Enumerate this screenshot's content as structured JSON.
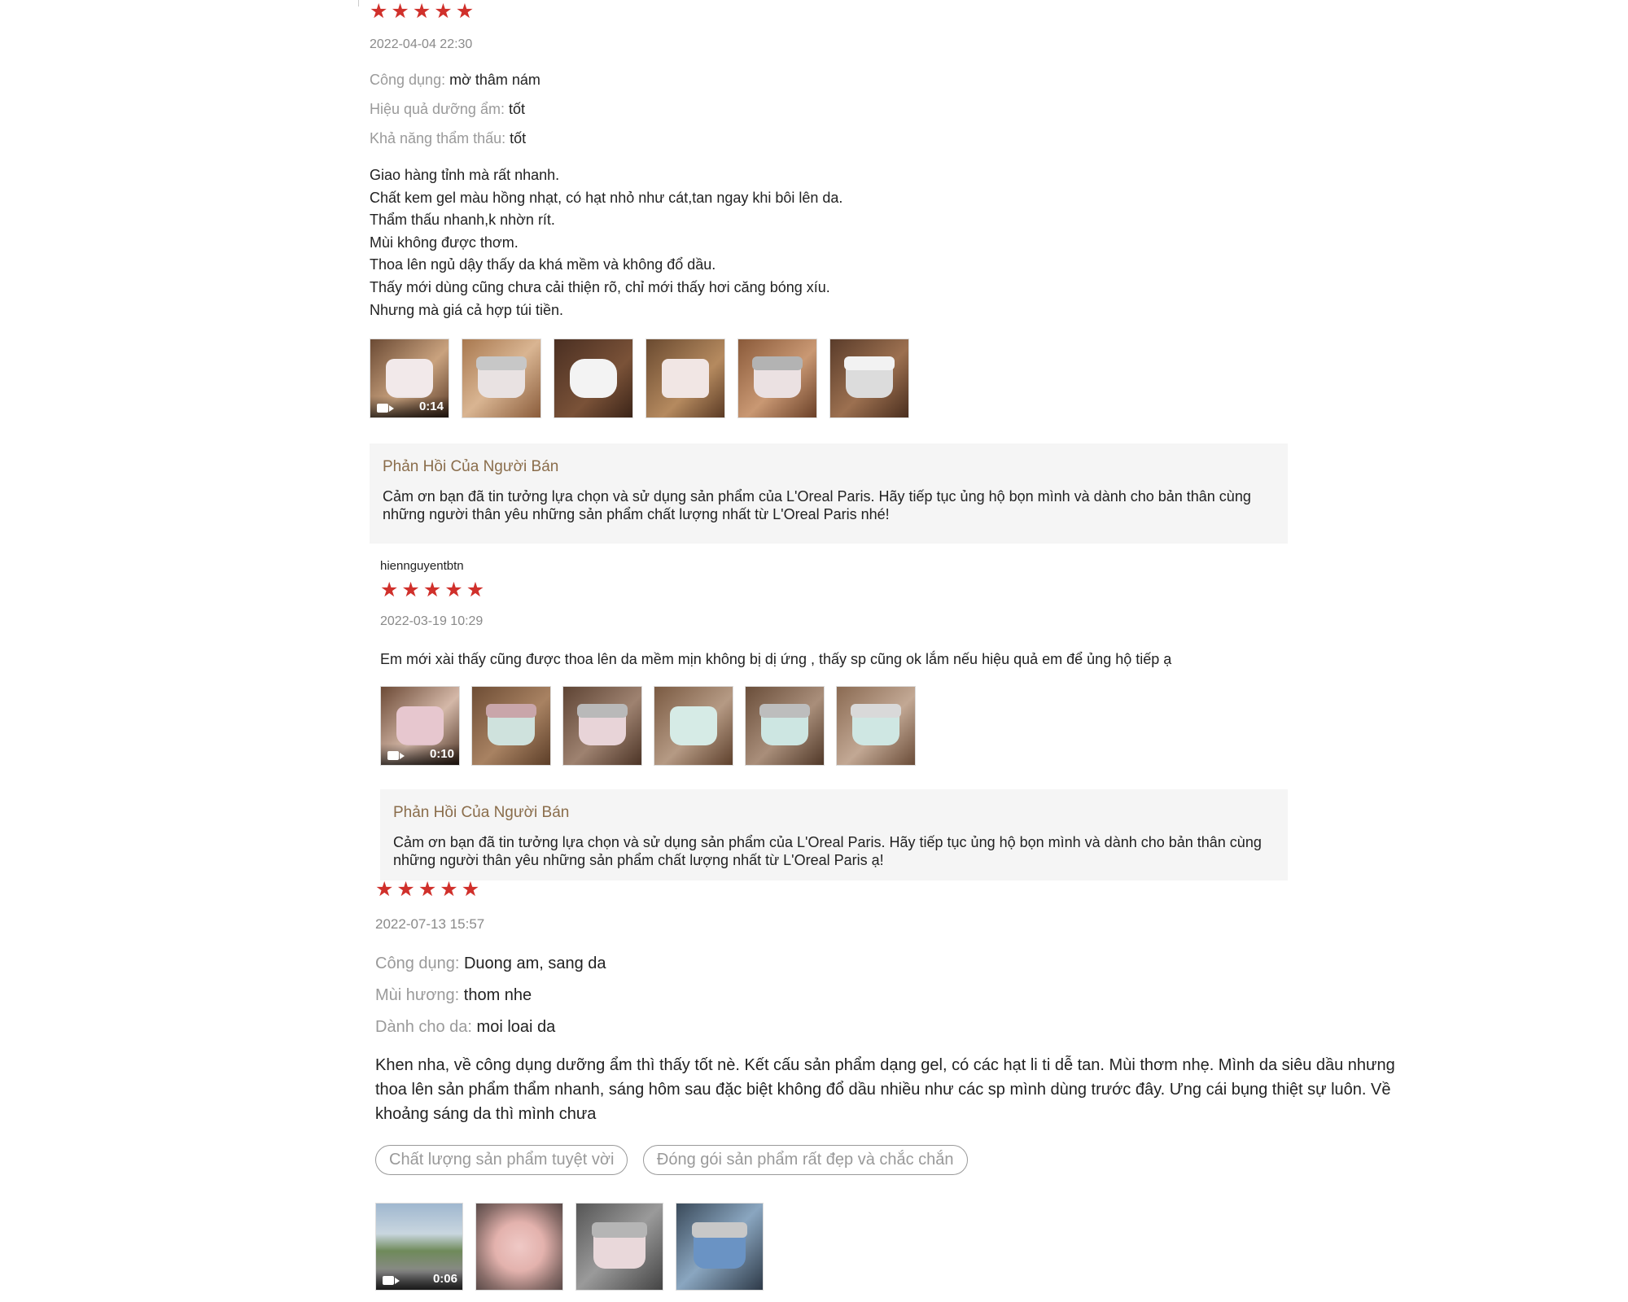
{
  "reviews": [
    {
      "username": "",
      "stars": 5,
      "date": "2022-04-04 22:30",
      "attributes": [
        {
          "label": "Công dụng:",
          "value": "mờ thâm nám"
        },
        {
          "label": "Hiệu quả dưỡng ẩm:",
          "value": "tốt"
        },
        {
          "label": "Khả năng thẩm thấu:",
          "value": "tốt"
        }
      ],
      "comment": "Giao hàng tỉnh mà rất nhanh.\nChất kem gel màu hồng nhạt, có hạt nhỏ như cát,tan ngay khi bôi lên da.\nThẩm thấu nhanh,k nhờn rít.\nMùi không được thơm.\nThoa lên ngủ dậy thấy da khá mềm và không đổ dầu.\nThấy mới dùng cũng chưa cải thiện rõ, chỉ mới thấy hơi căng bóng xíu.\nNhưng mà giá cả hợp túi tiền.",
      "video_duration": "0:14",
      "seller_reply": {
        "title": "Phản Hồi Của Người Bán",
        "text": "Cảm ơn bạn đã tin tưởng lựa chọn và sử dụng sản phẩm của L'Oreal Paris. Hãy tiếp tục ủng hộ bọn mình và dành cho bản thân cùng những người thân yêu những sản phẩm chất lượng nhất từ L'Oreal Paris  nhé!"
      }
    },
    {
      "username": "hiennguyentbtn",
      "stars": 5,
      "date": "2022-03-19 10:29",
      "comment": "Em mới xài thấy cũng được thoa lên da mềm mịn không bị dị ứng , thấy sp cũng ok lắm nếu hiệu quả em để ủng hộ tiếp ạ",
      "video_duration": "0:10",
      "seller_reply": {
        "title": "Phản Hồi Của Người Bán",
        "text": "Cảm ơn bạn đã tin tưởng lựa chọn và sử dụng sản phẩm của L'Oreal Paris. Hãy tiếp tục ủng hộ bọn mình và dành cho bản thân cùng những người thân yêu những sản phẩm chất lượng nhất từ L'Oreal Paris ạ!"
      }
    },
    {
      "stars": 5,
      "date": "2022-07-13 15:57",
      "attributes": [
        {
          "label": "Công dụng:",
          "value": "Duong am, sang da"
        },
        {
          "label": "Mùi hương:",
          "value": "thom nhe"
        },
        {
          "label": "Dành cho da:",
          "value": "moi loai da"
        }
      ],
      "comment": "Khen nha, về công dụng dưỡng ẩm thì thấy tốt nè. Kết cấu sản phẩm dạng gel, có các hạt li ti dễ tan. Mùi thơm nhẹ. Mình da siêu dầu nhưng thoa lên sản phẩm thẩm nhanh, sáng hôm sau đặc biệt không đổ dầu nhiều như các sp mình dùng trước đây. Ưng cái bụng thiệt sự luôn. Về khoảng sáng da thì mình chưa",
      "tags": [
        "Chất lượng sản phẩm tuyệt vời",
        "Đóng gói sản phẩm rất đẹp và chắc chắn"
      ],
      "video_duration": "0:06"
    }
  ],
  "colors": {
    "star": "#d0302b",
    "reply_bg": "#f5f5f5",
    "reply_title": "#8a6d4b",
    "muted": "#9a9a9a"
  },
  "icons": {
    "star": "★",
    "video": "video-camera-icon"
  }
}
